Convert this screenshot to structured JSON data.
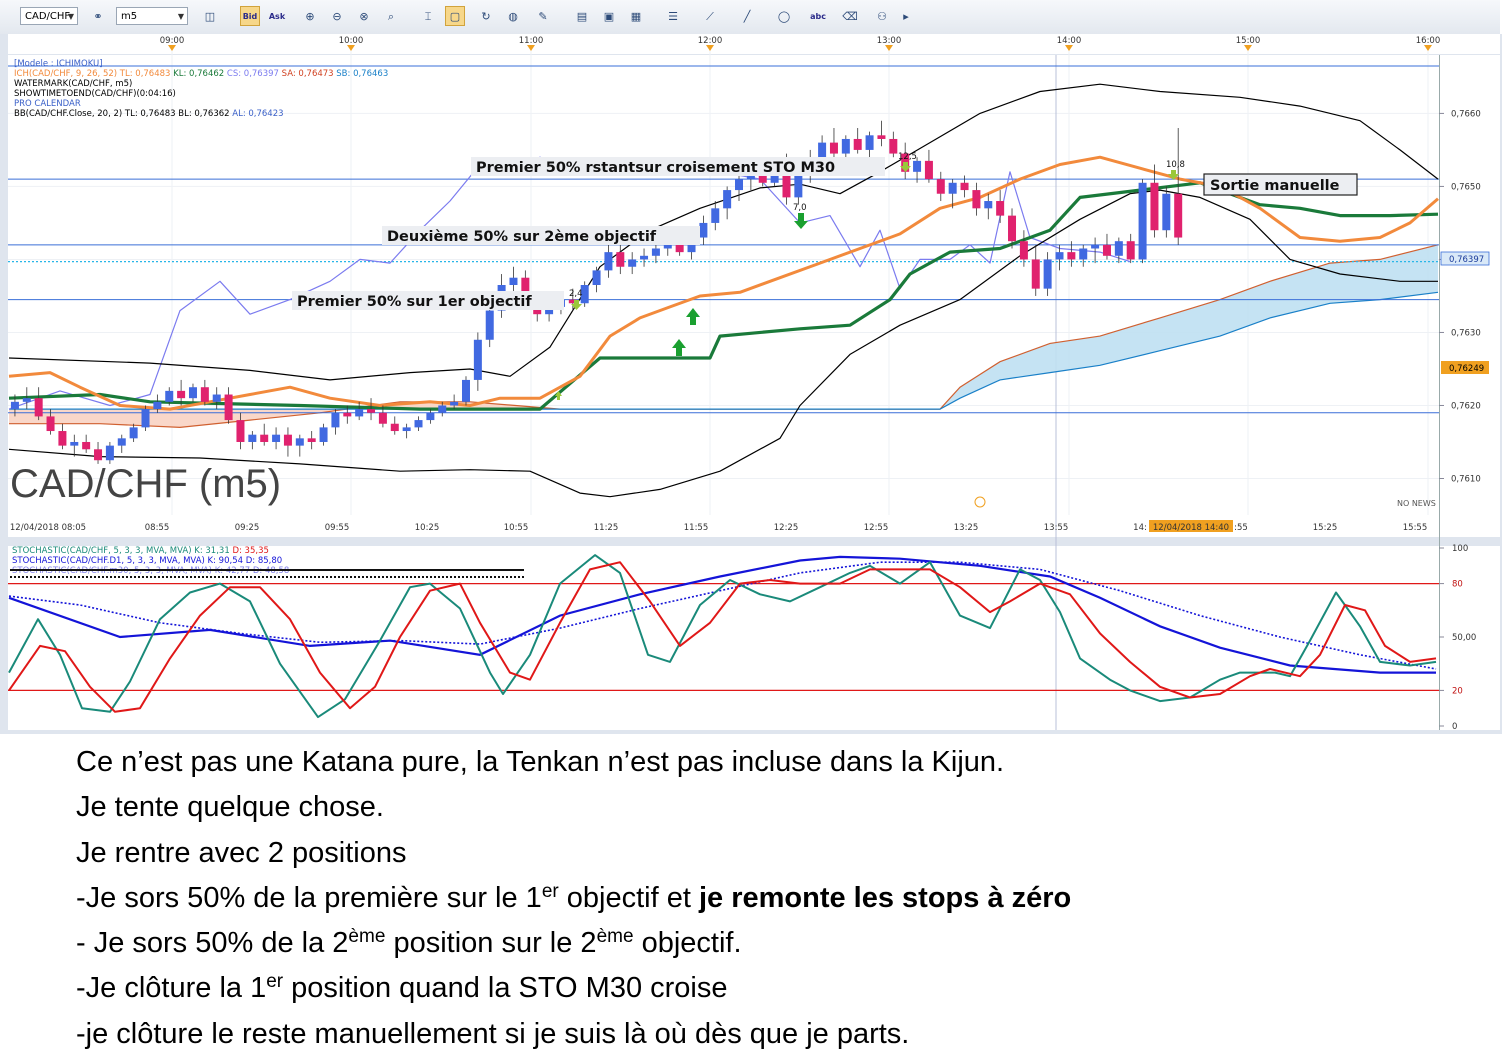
{
  "toolbar": {
    "symbol": "CAD/CHF",
    "timeframe": "m5",
    "bid_label": "Bid",
    "ask_label": "Ask"
  },
  "time_axis_top": [
    "09:00",
    "10:00",
    "11:00",
    "12:00",
    "13:00",
    "14:00",
    "15:00",
    "16:00"
  ],
  "time_axis_bottom": [
    "12/04/2018 08:05",
    "08:55",
    "09:25",
    "09:55",
    "10:25",
    "10:55",
    "11:25",
    "11:55",
    "12:25",
    "12:55",
    "13:25",
    "13:55",
    "14:",
    "12/04/2018 14:40",
    ":55",
    "15:25",
    "15:55"
  ],
  "price_axis": [
    "0,7660",
    "0,7650",
    "0,7640",
    "0,7630",
    "0,7620",
    "0,7610"
  ],
  "price_markers": {
    "current": "0,76397",
    "level": "0,76249"
  },
  "legend": {
    "model": "[Modele : ICHIMOKU]",
    "ich": "ICH(CAD/CHF, 9, 26, 52)",
    "ich_tl": "TL: 0,76483",
    "ich_kl": "KL: 0,76462",
    "ich_cs": "CS: 0,76397",
    "ich_sa": "SA: 0,76473",
    "ich_sb": "SB: 0,76463",
    "watermark": "WATERMARK(CAD/CHF, m5)",
    "showtime": "SHOWTIMETOEND(CAD/CHF)(0:04:16)",
    "calendar": "PRO CALENDAR",
    "bb": "BB(CAD/CHF.Close, 20, 2)",
    "bb_tl": "TL: 0,76483",
    "bb_bl": "BL: 0,76362",
    "bb_al": "AL: 0,76423"
  },
  "watermark": "CAD/CHF (m5)",
  "no_news": "NO NEWS",
  "annotations": {
    "first_obj": "Premier 50% sur 1er objectif",
    "second_obj": "Deuxième  50% sur 2ème objectif",
    "sto_cross": "Premier 50% rstantsur croisement STO M30",
    "manual_exit": "Sortie manuelle",
    "sig1": "2,4",
    "sig2": "7,0",
    "sig3": "12,5",
    "sig4": "10,8"
  },
  "stoch_legend": {
    "s1": "STOCHASTIC(CAD/CHF, 5, 3, 3, MVA, MVA)",
    "s1_k": "K: 31,31",
    "s1_d": "D: 35,35",
    "s2": "STOCHASTIC(CAD/CHF.D1, 5, 3, 3, MVA, MVA)",
    "s2_k": "K: 90,54",
    "s2_d": "D: 85,80",
    "s3": "STOCHASTIC(CAD/CHF.m30, 5, 3, 3, MVA, MVA)",
    "s3_k": "K: 42,77",
    "s3_d": "D: 48,58"
  },
  "stoch_axis": [
    "100",
    "80",
    "50,00",
    "20",
    "0"
  ],
  "colors": {
    "bull": "#4169e1",
    "bear": "#e0226e",
    "tenkan": "#f28a3c",
    "kijun": "#1a7a3a",
    "bollinger": "#000000",
    "chikou": "#7b7bef",
    "cloud_bull": "#bfe0f2",
    "cloud_bear": "#f8d3c3",
    "hline": "#3a6fd8",
    "stoch_k": "#1a8a7a",
    "stoch_d": "#e01818",
    "stoch_d1": "#1414d8"
  },
  "chart_data": {
    "type": "candlestick",
    "symbol": "CAD/CHF",
    "timeframe": "m5",
    "ylim": [
      0.7605,
      0.7668
    ],
    "hlines": [
      0.76665,
      0.7651,
      0.7642,
      0.76397,
      0.76345,
      0.7619
    ],
    "candles": [
      {
        "o": 0.76195,
        "h": 0.76215,
        "l": 0.76185,
        "c": 0.76205
      },
      {
        "o": 0.76205,
        "h": 0.76225,
        "l": 0.76195,
        "c": 0.7621
      },
      {
        "o": 0.7621,
        "h": 0.76225,
        "l": 0.7618,
        "c": 0.76185
      },
      {
        "o": 0.76185,
        "h": 0.76195,
        "l": 0.7616,
        "c": 0.76165
      },
      {
        "o": 0.76165,
        "h": 0.76175,
        "l": 0.7614,
        "c": 0.76145
      },
      {
        "o": 0.76145,
        "h": 0.7616,
        "l": 0.7613,
        "c": 0.7615
      },
      {
        "o": 0.7615,
        "h": 0.7616,
        "l": 0.76135,
        "c": 0.7614
      },
      {
        "o": 0.7614,
        "h": 0.7615,
        "l": 0.7612,
        "c": 0.76125
      },
      {
        "o": 0.76125,
        "h": 0.7615,
        "l": 0.7612,
        "c": 0.76145
      },
      {
        "o": 0.76145,
        "h": 0.7616,
        "l": 0.76135,
        "c": 0.76155
      },
      {
        "o": 0.76155,
        "h": 0.76175,
        "l": 0.7615,
        "c": 0.7617
      },
      {
        "o": 0.7617,
        "h": 0.762,
        "l": 0.76165,
        "c": 0.76195
      },
      {
        "o": 0.76195,
        "h": 0.76215,
        "l": 0.7619,
        "c": 0.76205
      },
      {
        "o": 0.76205,
        "h": 0.76225,
        "l": 0.762,
        "c": 0.7622
      },
      {
        "o": 0.7622,
        "h": 0.76235,
        "l": 0.762,
        "c": 0.7621
      },
      {
        "o": 0.7621,
        "h": 0.7623,
        "l": 0.76205,
        "c": 0.76225
      },
      {
        "o": 0.76225,
        "h": 0.76235,
        "l": 0.762,
        "c": 0.76205
      },
      {
        "o": 0.76205,
        "h": 0.76225,
        "l": 0.76195,
        "c": 0.76215
      },
      {
        "o": 0.76215,
        "h": 0.76225,
        "l": 0.76175,
        "c": 0.7618
      },
      {
        "o": 0.7618,
        "h": 0.7619,
        "l": 0.7614,
        "c": 0.7615
      },
      {
        "o": 0.7615,
        "h": 0.76165,
        "l": 0.7614,
        "c": 0.7616
      },
      {
        "o": 0.7616,
        "h": 0.76175,
        "l": 0.76145,
        "c": 0.7615
      },
      {
        "o": 0.7615,
        "h": 0.7617,
        "l": 0.7614,
        "c": 0.7616
      },
      {
        "o": 0.7616,
        "h": 0.7617,
        "l": 0.7613,
        "c": 0.76145
      },
      {
        "o": 0.76145,
        "h": 0.7616,
        "l": 0.7613,
        "c": 0.76155
      },
      {
        "o": 0.76155,
        "h": 0.76165,
        "l": 0.7614,
        "c": 0.7615
      },
      {
        "o": 0.7615,
        "h": 0.76175,
        "l": 0.76145,
        "c": 0.7617
      },
      {
        "o": 0.7617,
        "h": 0.76195,
        "l": 0.7616,
        "c": 0.7619
      },
      {
        "o": 0.7619,
        "h": 0.762,
        "l": 0.76175,
        "c": 0.76185
      },
      {
        "o": 0.76185,
        "h": 0.76205,
        "l": 0.7618,
        "c": 0.76195
      },
      {
        "o": 0.76195,
        "h": 0.7621,
        "l": 0.7618,
        "c": 0.7619
      },
      {
        "o": 0.7619,
        "h": 0.762,
        "l": 0.7617,
        "c": 0.76175
      },
      {
        "o": 0.76175,
        "h": 0.76185,
        "l": 0.7616,
        "c": 0.76165
      },
      {
        "o": 0.76165,
        "h": 0.76175,
        "l": 0.76155,
        "c": 0.7617
      },
      {
        "o": 0.7617,
        "h": 0.76185,
        "l": 0.76165,
        "c": 0.7618
      },
      {
        "o": 0.7618,
        "h": 0.76195,
        "l": 0.76175,
        "c": 0.7619
      },
      {
        "o": 0.7619,
        "h": 0.76205,
        "l": 0.76185,
        "c": 0.762
      },
      {
        "o": 0.762,
        "h": 0.76215,
        "l": 0.76195,
        "c": 0.76205
      },
      {
        "o": 0.76205,
        "h": 0.7624,
        "l": 0.762,
        "c": 0.76235
      },
      {
        "o": 0.76235,
        "h": 0.763,
        "l": 0.7622,
        "c": 0.7629
      },
      {
        "o": 0.7629,
        "h": 0.7634,
        "l": 0.7628,
        "c": 0.7633
      },
      {
        "o": 0.7633,
        "h": 0.7638,
        "l": 0.7632,
        "c": 0.76365
      },
      {
        "o": 0.76365,
        "h": 0.7639,
        "l": 0.76345,
        "c": 0.76375
      },
      {
        "o": 0.76375,
        "h": 0.76385,
        "l": 0.7634,
        "c": 0.76345
      },
      {
        "o": 0.76345,
        "h": 0.76355,
        "l": 0.76315,
        "c": 0.76325
      },
      {
        "o": 0.76325,
        "h": 0.76345,
        "l": 0.76315,
        "c": 0.76335
      },
      {
        "o": 0.76335,
        "h": 0.7635,
        "l": 0.76325,
        "c": 0.76345
      },
      {
        "o": 0.76345,
        "h": 0.7636,
        "l": 0.7633,
        "c": 0.7634
      },
      {
        "o": 0.7634,
        "h": 0.7637,
        "l": 0.76335,
        "c": 0.76365
      },
      {
        "o": 0.76365,
        "h": 0.7639,
        "l": 0.76355,
        "c": 0.76385
      },
      {
        "o": 0.76385,
        "h": 0.7642,
        "l": 0.76375,
        "c": 0.7641
      },
      {
        "o": 0.7641,
        "h": 0.7642,
        "l": 0.7638,
        "c": 0.7639
      },
      {
        "o": 0.7639,
        "h": 0.7641,
        "l": 0.7638,
        "c": 0.764
      },
      {
        "o": 0.764,
        "h": 0.76415,
        "l": 0.7639,
        "c": 0.76405
      },
      {
        "o": 0.76405,
        "h": 0.76425,
        "l": 0.76395,
        "c": 0.76415
      },
      {
        "o": 0.76415,
        "h": 0.7644,
        "l": 0.76405,
        "c": 0.7643
      },
      {
        "o": 0.7643,
        "h": 0.7644,
        "l": 0.76405,
        "c": 0.7641
      },
      {
        "o": 0.7641,
        "h": 0.7644,
        "l": 0.764,
        "c": 0.7643
      },
      {
        "o": 0.7643,
        "h": 0.7646,
        "l": 0.7642,
        "c": 0.7645
      },
      {
        "o": 0.7645,
        "h": 0.7648,
        "l": 0.7644,
        "c": 0.7647
      },
      {
        "o": 0.7647,
        "h": 0.765,
        "l": 0.76455,
        "c": 0.76495
      },
      {
        "o": 0.76495,
        "h": 0.7652,
        "l": 0.7648,
        "c": 0.7651
      },
      {
        "o": 0.7651,
        "h": 0.7653,
        "l": 0.76495,
        "c": 0.76525
      },
      {
        "o": 0.76525,
        "h": 0.76535,
        "l": 0.765,
        "c": 0.76505
      },
      {
        "o": 0.76505,
        "h": 0.7654,
        "l": 0.765,
        "c": 0.76535
      },
      {
        "o": 0.76535,
        "h": 0.76545,
        "l": 0.76475,
        "c": 0.76485
      },
      {
        "o": 0.76485,
        "h": 0.7652,
        "l": 0.76475,
        "c": 0.76515
      },
      {
        "o": 0.76515,
        "h": 0.7655,
        "l": 0.76505,
        "c": 0.7654
      },
      {
        "o": 0.7654,
        "h": 0.7657,
        "l": 0.7653,
        "c": 0.7656
      },
      {
        "o": 0.7656,
        "h": 0.7658,
        "l": 0.7654,
        "c": 0.76545
      },
      {
        "o": 0.76545,
        "h": 0.7657,
        "l": 0.76535,
        "c": 0.76565
      },
      {
        "o": 0.76565,
        "h": 0.7658,
        "l": 0.76545,
        "c": 0.7655
      },
      {
        "o": 0.7655,
        "h": 0.76575,
        "l": 0.7654,
        "c": 0.7657
      },
      {
        "o": 0.7657,
        "h": 0.7659,
        "l": 0.76555,
        "c": 0.76565
      },
      {
        "o": 0.76565,
        "h": 0.76575,
        "l": 0.7654,
        "c": 0.76545
      },
      {
        "o": 0.76545,
        "h": 0.7656,
        "l": 0.7651,
        "c": 0.7652
      },
      {
        "o": 0.7652,
        "h": 0.7654,
        "l": 0.76505,
        "c": 0.76535
      },
      {
        "o": 0.76535,
        "h": 0.7655,
        "l": 0.76505,
        "c": 0.7651
      },
      {
        "o": 0.7651,
        "h": 0.7652,
        "l": 0.7648,
        "c": 0.7649
      },
      {
        "o": 0.7649,
        "h": 0.7651,
        "l": 0.7647,
        "c": 0.76505
      },
      {
        "o": 0.76505,
        "h": 0.76515,
        "l": 0.76485,
        "c": 0.76495
      },
      {
        "o": 0.76495,
        "h": 0.76505,
        "l": 0.7646,
        "c": 0.7647
      },
      {
        "o": 0.7647,
        "h": 0.7649,
        "l": 0.76455,
        "c": 0.7648
      },
      {
        "o": 0.7648,
        "h": 0.76495,
        "l": 0.7645,
        "c": 0.7646
      },
      {
        "o": 0.7646,
        "h": 0.7647,
        "l": 0.76415,
        "c": 0.76425
      },
      {
        "o": 0.76425,
        "h": 0.7644,
        "l": 0.7639,
        "c": 0.764
      },
      {
        "o": 0.764,
        "h": 0.7642,
        "l": 0.7635,
        "c": 0.7636
      },
      {
        "o": 0.7636,
        "h": 0.7641,
        "l": 0.7635,
        "c": 0.764
      },
      {
        "o": 0.764,
        "h": 0.7642,
        "l": 0.76385,
        "c": 0.7641
      },
      {
        "o": 0.7641,
        "h": 0.76425,
        "l": 0.7639,
        "c": 0.764
      },
      {
        "o": 0.764,
        "h": 0.7642,
        "l": 0.7639,
        "c": 0.76415
      },
      {
        "o": 0.76415,
        "h": 0.7643,
        "l": 0.76395,
        "c": 0.7642
      },
      {
        "o": 0.7642,
        "h": 0.76435,
        "l": 0.764,
        "c": 0.76405
      },
      {
        "o": 0.76405,
        "h": 0.7643,
        "l": 0.76395,
        "c": 0.76425
      },
      {
        "o": 0.76425,
        "h": 0.76435,
        "l": 0.76395,
        "c": 0.764
      },
      {
        "o": 0.764,
        "h": 0.7651,
        "l": 0.76395,
        "c": 0.76505
      },
      {
        "o": 0.76505,
        "h": 0.7653,
        "l": 0.7643,
        "c": 0.7644
      },
      {
        "o": 0.7644,
        "h": 0.765,
        "l": 0.7643,
        "c": 0.7649
      },
      {
        "o": 0.7649,
        "h": 0.7658,
        "l": 0.7642,
        "c": 0.7643
      }
    ]
  }
}
